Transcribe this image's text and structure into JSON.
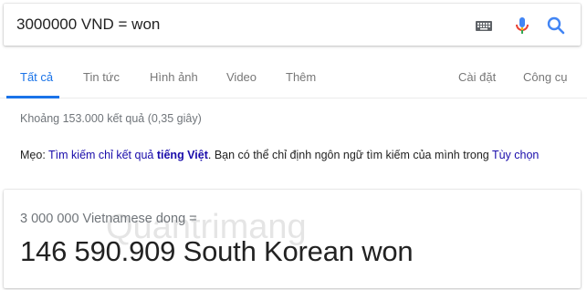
{
  "search": {
    "query": "3000000 VND = won"
  },
  "tabs": [
    {
      "label": "Tất cả"
    },
    {
      "label": "Tin tức"
    },
    {
      "label": "Hình ảnh"
    },
    {
      "label": "Video"
    },
    {
      "label": "Thêm"
    },
    {
      "label": "Cài đặt"
    },
    {
      "label": "Công cụ"
    }
  ],
  "results": {
    "stats": "Khoảng 153.000 kết quả (0,35 giây)"
  },
  "tip": {
    "prefix": "Mẹo: ",
    "link_text": "Tìm kiếm chỉ kết quả ",
    "link_bold": "tiếng Việt",
    "middle": ". Bạn có thể chỉ định ngôn ngữ tìm kiếm của mình trong ",
    "settings_link": "Tùy chọn"
  },
  "converter": {
    "source": "3 000 000 Vietnamese dong =",
    "result": "146 590.909 South Korean won"
  },
  "watermark": {
    "text": "Quantrimang"
  },
  "colors": {
    "accent": "#1a73e8",
    "link": "#1a0dab",
    "mic_red": "#ea4335"
  },
  "icons": {
    "keyboard": "keyboard-icon",
    "mic": "microphone-icon",
    "search": "search-icon"
  }
}
